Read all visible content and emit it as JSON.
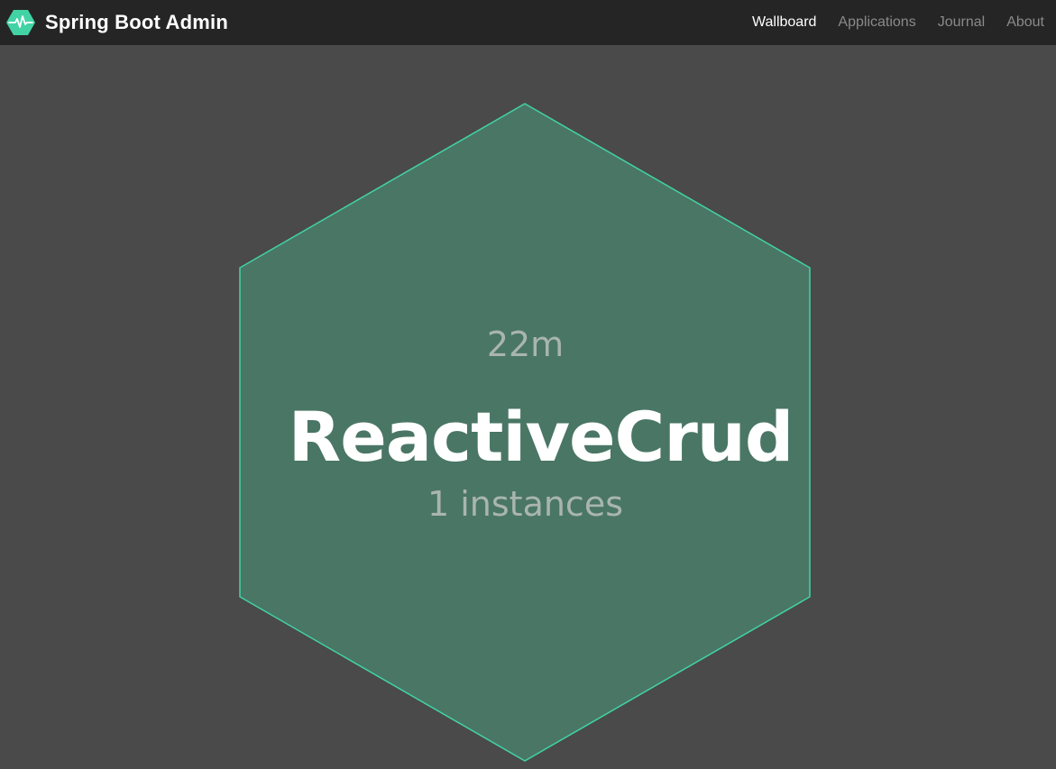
{
  "brand": {
    "title": "Spring Boot Admin",
    "logo_icon": "heartbeat-hexagon-icon"
  },
  "nav": {
    "items": [
      {
        "label": "Wallboard",
        "active": true
      },
      {
        "label": "Applications",
        "active": false
      },
      {
        "label": "Journal",
        "active": false
      },
      {
        "label": "About",
        "active": false
      }
    ]
  },
  "wallboard": {
    "application": {
      "uptime": "22m",
      "name": "ReactiveCrud",
      "instances": "1 instances",
      "status_color": "#42d3a5",
      "fill_color": "#4a7666"
    }
  },
  "colors": {
    "background": "#4a4a4a",
    "navbar": "#252525",
    "accent": "#42d3a5"
  }
}
